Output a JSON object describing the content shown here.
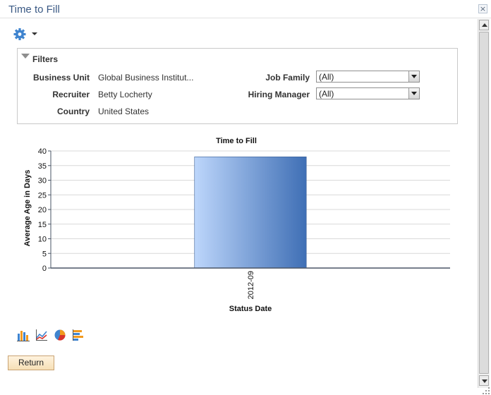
{
  "window": {
    "title": "Time to Fill",
    "close_glyph": "×"
  },
  "toolbar": {
    "gear_icon": "gear-icon",
    "menu_caret": "chevron-down-icon"
  },
  "filters": {
    "title": "Filters",
    "fields": [
      {
        "label": "Business Unit",
        "value": "Global Business Institut..."
      },
      {
        "label": "Recruiter",
        "value": "Betty Locherty"
      },
      {
        "label": "Country",
        "value": "United States"
      }
    ],
    "selects": [
      {
        "label": "Job Family",
        "value": "(All)"
      },
      {
        "label": "Hiring Manager",
        "value": "(All)"
      }
    ]
  },
  "chart_data": {
    "type": "bar",
    "title": "Time to Fill",
    "xlabel": "Status Date",
    "ylabel": "Average Age in Days",
    "categories": [
      "2012-09"
    ],
    "values": [
      38
    ],
    "ylim": [
      0,
      40
    ],
    "yticks": [
      0,
      5,
      10,
      15,
      20,
      25,
      30,
      35,
      40
    ],
    "grid": true,
    "legend": "none",
    "colors": {
      "bar_light": "#bdd6fb",
      "bar_dark": "#3f6fb5",
      "grid": "#d9d9d9",
      "axis": "#4a5566"
    }
  },
  "chart_types": [
    {
      "name": "bar-chart-icon"
    },
    {
      "name": "line-chart-icon"
    },
    {
      "name": "pie-chart-icon"
    },
    {
      "name": "horizontal-bar-chart-icon"
    }
  ],
  "actions": {
    "return_label": "Return"
  }
}
